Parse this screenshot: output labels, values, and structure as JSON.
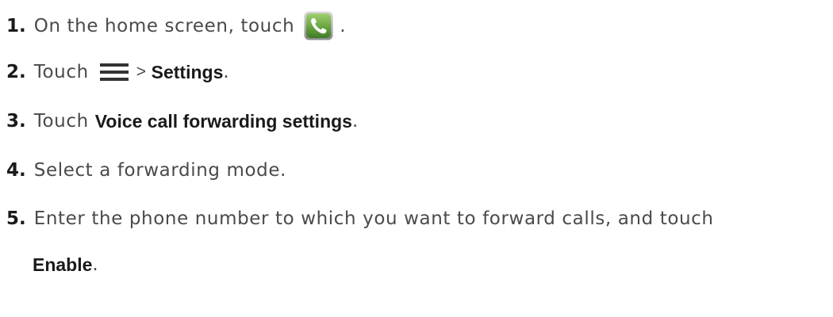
{
  "steps": [
    {
      "number": "1.",
      "text_before": "On the home screen, touch",
      "icon": "phone-app-icon",
      "text_after": "."
    },
    {
      "number": "2.",
      "text_before": "Touch",
      "icon": "menu-icon",
      "separator": ">",
      "bold": "Settings",
      "text_after": "."
    },
    {
      "number": "3.",
      "text_before": "Touch",
      "bold": "Voice call forwarding settings",
      "text_after": "."
    },
    {
      "number": "4.",
      "text": "Select a forwarding mode."
    },
    {
      "number": "5.",
      "text": "Enter the phone number to which you want to forward calls, and touch",
      "bold": "Enable",
      "text_after": "."
    }
  ],
  "colors": {
    "text": "#4a4a4a",
    "emphasis": "#1a1a1a",
    "icon_green": "#5f9a3c"
  }
}
